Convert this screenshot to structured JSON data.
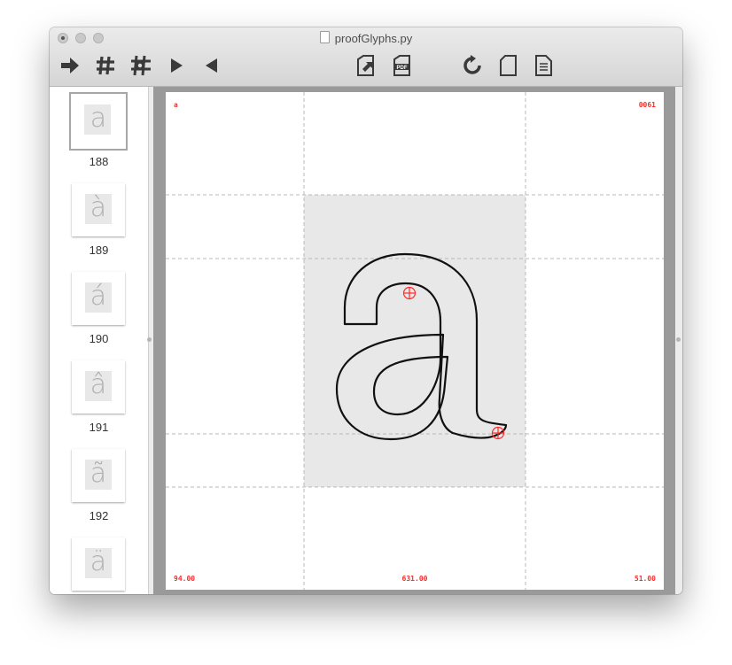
{
  "window": {
    "title": "proofGlyphs.py"
  },
  "toolbar": {
    "buttons": [
      "arrow-right",
      "grid",
      "settings-grid",
      "play",
      "play-back",
      "export",
      "pdf",
      "refresh",
      "page",
      "document"
    ]
  },
  "sidebar": {
    "pages": [
      {
        "num": "188",
        "glyph": "a"
      },
      {
        "num": "189",
        "glyph": "à"
      },
      {
        "num": "190",
        "glyph": "á"
      },
      {
        "num": "191",
        "glyph": "â"
      },
      {
        "num": "192",
        "glyph": "ã"
      },
      {
        "num": "",
        "glyph": "ä"
      }
    ]
  },
  "page": {
    "glyph_name": "a",
    "unicode": "0061",
    "left_margin": "94.00",
    "width": "631.00",
    "right_margin": "51.00"
  },
  "colors": {
    "accent": "#ff2a2a",
    "outline": "#111111"
  }
}
